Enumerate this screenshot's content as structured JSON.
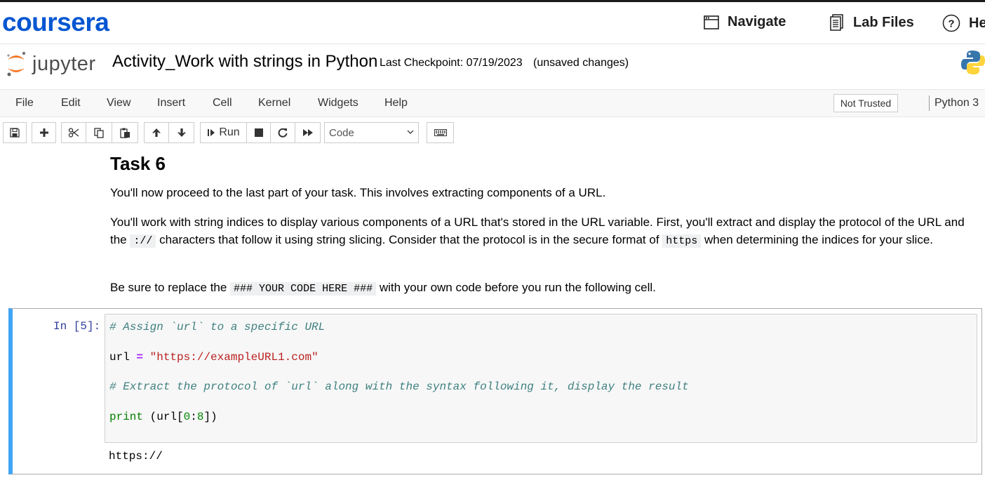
{
  "coursera": {
    "logo": "coursera",
    "nav": [
      {
        "label": "Navigate",
        "icon": "browser-window-icon"
      },
      {
        "label": "Lab Files",
        "icon": "document-files-icon"
      },
      {
        "label": "He",
        "icon": "help-circle-icon"
      }
    ]
  },
  "jupyter": {
    "logo_text": "jupyter",
    "notebook_title": "Activity_Work with strings in Python",
    "checkpoint": "Last Checkpoint: 07/19/2023",
    "save_status": "(unsaved changes)"
  },
  "menubar": {
    "items": [
      "File",
      "Edit",
      "View",
      "Insert",
      "Cell",
      "Kernel",
      "Widgets",
      "Help"
    ],
    "trust_status": "Not Trusted",
    "kernel": "Python 3"
  },
  "toolbar": {
    "run_label": "Run",
    "cell_type": "Code",
    "buttons": [
      "save-icon",
      "add-cell-icon",
      "cut-icon",
      "copy-icon",
      "paste-icon",
      "move-up-icon",
      "move-down-icon",
      "run-icon",
      "stop-icon",
      "restart-icon",
      "fast-forward-icon",
      "keyboard-icon"
    ]
  },
  "markdown": {
    "heading": "Task 6",
    "p1": "You'll now proceed to the last part of your task. This involves extracting components of a URL.",
    "p2_a": "You'll work with string indices to display various components of a URL that's stored in the URL variable. First, you'll extract and display the protocol of the URL and the ",
    "p2_code1": "://",
    "p2_b": " characters that follow it using string slicing. Consider that the protocol is in the secure format of ",
    "p2_code2": "https",
    "p2_c": " when determining the indices for your slice.",
    "p3_a": "Be sure to replace the ",
    "p3_code": "### YOUR CODE HERE ###",
    "p3_b": " with your own code before you run the following cell."
  },
  "cell": {
    "prompt": "In [5]:",
    "line1_comment": "# Assign `url` to a specific URL",
    "line2_var": "url ",
    "line2_op": "=",
    "line2_str": "\"https://exampleURL1.com\"",
    "line3_comment": "# Extract the protocol of `url` along with the syntax following it, display the result",
    "line4_fn": "print",
    "line4_a": " (url[",
    "line4_n1": "0",
    "line4_colon": ":",
    "line4_n2": "8",
    "line4_b": "])",
    "output": "https://"
  }
}
